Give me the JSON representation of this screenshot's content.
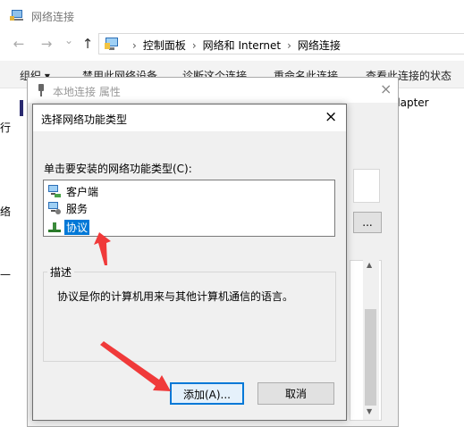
{
  "explorer": {
    "title": "网络连接",
    "nav_back": "←",
    "nav_forward": "→",
    "nav_dropdown": "⌄",
    "nav_up": "↑",
    "breadcrumbs": [
      "控制面板",
      "网络和 Internet",
      "网络连接"
    ],
    "commands": [
      "组织 ▾",
      "禁用此网络设备",
      "诊断这个连接",
      "重命名此连接",
      "查看此连接的状态"
    ],
    "adapter_fragment": "dapter",
    "edge_fragments": [
      "行",
      "络",
      "—"
    ]
  },
  "properties_dialog": {
    "title": "本地连接 属性",
    "close": "×",
    "btn_fragment": "..."
  },
  "feature_dialog": {
    "title": "选择网络功能类型",
    "close": "×",
    "prompt": "单击要安装的网络功能类型(C):",
    "items": [
      {
        "label": "客户端",
        "icon": "client-icon"
      },
      {
        "label": "服务",
        "icon": "service-icon"
      },
      {
        "label": "协议",
        "icon": "protocol-icon",
        "selected": true
      }
    ],
    "description_legend": "描述",
    "description_text": "协议是你的计算机用来与其他计算机通信的语言。",
    "add_label": "添加(A)...",
    "cancel_label": "取消"
  },
  "colors": {
    "selection": "#0078d7",
    "annotation_arrow": "#f03a3a"
  }
}
